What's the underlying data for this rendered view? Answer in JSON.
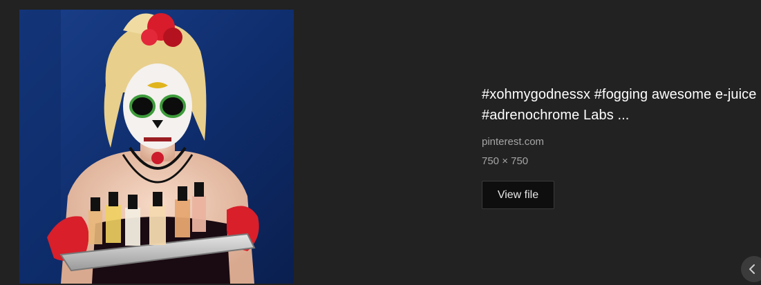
{
  "preview": {
    "image_description": "sugar-skull-model-holding-e-juice-tray"
  },
  "info": {
    "title": "#xohmygodnessx #fogging awesome e-juice #adrenochrome Labs ...",
    "source": "pinterest.com",
    "dimensions": "750 × 750",
    "view_file_label": "View file"
  },
  "nav": {
    "prev_icon": "chevron-left-icon"
  },
  "colors": {
    "background": "#222222",
    "title": "#ffffff",
    "meta": "#a5a5a5",
    "button_bg": "#0e0e0e"
  }
}
